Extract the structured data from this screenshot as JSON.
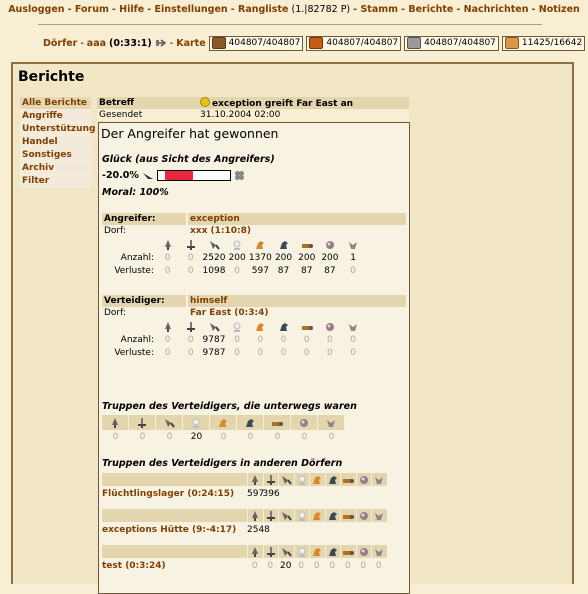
{
  "topnav": {
    "items": [
      "Ausloggen",
      "Forum",
      "Hilfe",
      "Einstellungen",
      "Rangliste"
    ],
    "rank": "(1.|82782 P)",
    "items2": [
      "Stamm",
      "Berichte",
      "Nachrichten",
      "Notizen"
    ]
  },
  "villagebar": {
    "doerfer": "Dörfer",
    "village": "aaa",
    "coords": "(0:33:1)",
    "karte": "Karte",
    "wood": "404807/404807",
    "clay": "404807/404807",
    "iron": "404807/404807",
    "farm": "11425/16642"
  },
  "page": {
    "title": "Berichte",
    "menu": [
      "Alle Berichte",
      "Angriffe",
      "Unterstützung",
      "Handel",
      "Sonstiges",
      "Archiv",
      "Filter"
    ]
  },
  "header": {
    "betreff_label": "Betreff",
    "subject": "exception greift Far East an",
    "gesendet_label": "Gesendet",
    "date": "31.10.2004 02:00"
  },
  "report": {
    "winner": "Der Angreifer hat gewonnen",
    "luck_title": "Glück (aus Sicht des Angreifers)",
    "luck_value": "-20.0%",
    "luck_fraction": -0.2,
    "moral": "Moral: 100%",
    "attacker": {
      "label": "Angreifer:",
      "name": "exception",
      "dorf_label": "Dorf:",
      "village": "xxx (1:10:8)",
      "anzahl_label": "Anzahl:",
      "verluste_label": "Verluste:",
      "anzahl": [
        "0",
        "0",
        "2520",
        "200",
        "1370",
        "200",
        "200",
        "200",
        "1"
      ],
      "verluste": [
        "0",
        "0",
        "1098",
        "0",
        "597",
        "87",
        "87",
        "87",
        "0"
      ]
    },
    "defender": {
      "label": "Verteidiger:",
      "name": "himself",
      "dorf_label": "Dorf:",
      "village": "Far East (0:3:4)",
      "anzahl_label": "Anzahl:",
      "verluste_label": "Verluste:",
      "anzahl": [
        "0",
        "0",
        "9787",
        "0",
        "0",
        "0",
        "0",
        "0",
        "0"
      ],
      "verluste": [
        "0",
        "0",
        "9787",
        "0",
        "0",
        "0",
        "0",
        "0",
        "0"
      ]
    },
    "away_title": "Truppen des Verteidigers, die unterwegs waren",
    "away": [
      "0",
      "0",
      "0",
      "20",
      "0",
      "0",
      "0",
      "0",
      "0"
    ],
    "other_title": "Truppen des Verteidigers in anderen Dörfern",
    "others": [
      {
        "name": "Flüchtlingslager (0:24:15)",
        "values": [
          "597",
          "396",
          "",
          "",
          "",
          "",
          "",
          "",
          ""
        ]
      },
      {
        "name": "exceptions Hütte (9:-4:17)",
        "values": [
          "2548",
          "",
          "",
          "",
          "",
          "",
          "",
          "",
          ""
        ]
      },
      {
        "name": "test (0:3:24)",
        "values": [
          "0",
          "0",
          "20",
          "0",
          "0",
          "0",
          "0",
          "0",
          "0"
        ]
      }
    ]
  },
  "units": [
    "spear-icon",
    "sword-icon",
    "axe-icon",
    "spy-icon",
    "light-cavalry-icon",
    "heavy-cavalry-icon",
    "ram-icon",
    "catapult-icon",
    "snob-icon"
  ],
  "colors": {
    "link": "#804000",
    "luck": "#e8283c",
    "bg": "#f7eed3"
  }
}
